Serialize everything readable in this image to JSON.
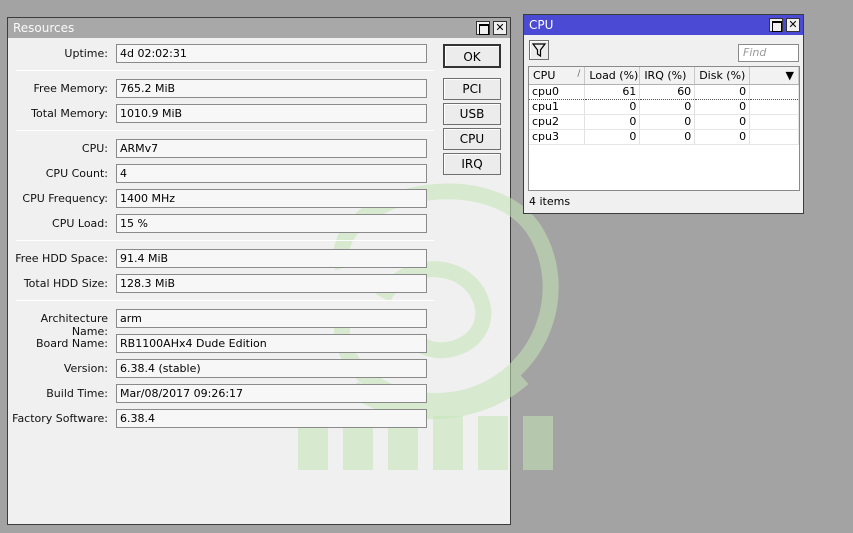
{
  "resources": {
    "title": "Resources",
    "fields": [
      {
        "label": "Uptime:",
        "value": "4d 02:02:31"
      },
      {
        "label": "Free Memory:",
        "value": "765.2 MiB"
      },
      {
        "label": "Total Memory:",
        "value": "1010.9 MiB"
      },
      {
        "label": "CPU:",
        "value": "ARMv7"
      },
      {
        "label": "CPU Count:",
        "value": "4"
      },
      {
        "label": "CPU Frequency:",
        "value": "1400 MHz"
      },
      {
        "label": "CPU Load:",
        "value": "15 %"
      },
      {
        "label": "Free HDD Space:",
        "value": "91.4 MiB"
      },
      {
        "label": "Total HDD Size:",
        "value": "128.3 MiB"
      },
      {
        "label": "Architecture Name:",
        "value": "arm"
      },
      {
        "label": "Board Name:",
        "value": "RB1100AHx4 Dude Edition"
      },
      {
        "label": "Version:",
        "value": "6.38.4 (stable)"
      },
      {
        "label": "Build Time:",
        "value": "Mar/08/2017 09:26:17"
      },
      {
        "label": "Factory Software:",
        "value": "6.38.4"
      }
    ],
    "buttons": {
      "ok": "OK",
      "pci": "PCI",
      "usb": "USB",
      "cpu": "CPU",
      "irq": "IRQ"
    }
  },
  "cpu_window": {
    "title": "CPU",
    "find_placeholder": "Find",
    "columns": [
      "CPU",
      "Load (%)",
      "IRQ (%)",
      "Disk (%)"
    ],
    "rows": [
      {
        "cpu": "cpu0",
        "load": "61",
        "irq": "60",
        "disk": "0"
      },
      {
        "cpu": "cpu1",
        "load": "0",
        "irq": "0",
        "disk": "0"
      },
      {
        "cpu": "cpu2",
        "load": "0",
        "irq": "0",
        "disk": "0"
      },
      {
        "cpu": "cpu3",
        "load": "0",
        "irq": "0",
        "disk": "0"
      }
    ],
    "status": "4 items"
  },
  "icons": {
    "maximize": "maximize-icon",
    "close": "close-icon",
    "filter": "filter-icon",
    "sort": "sort-icon",
    "dropdown": "chevron-down-icon"
  },
  "colors": {
    "desktop": "#a3a3a3",
    "active_title": "#4a4ad4",
    "inactive_title": "#a8a8a8",
    "watermark": "#bfe3b0"
  }
}
